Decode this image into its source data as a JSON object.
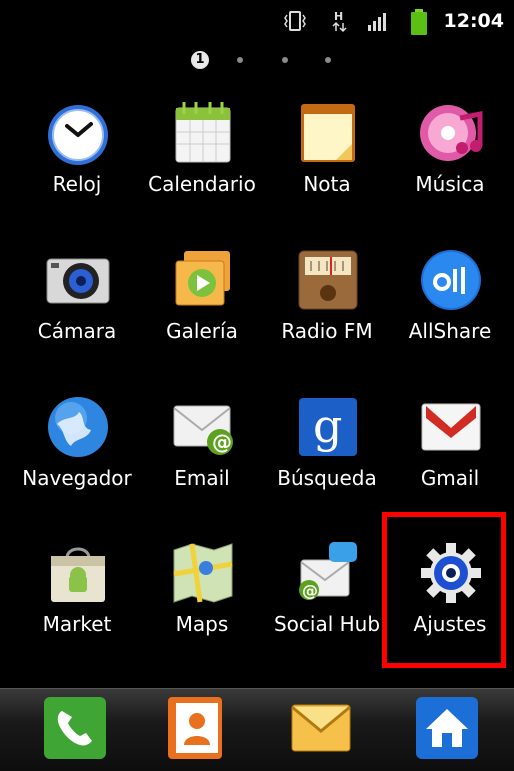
{
  "status_bar": {
    "time": "12:04",
    "icons": [
      "vibrate-icon",
      "hspa-data-icon",
      "signal-icon",
      "battery-icon"
    ]
  },
  "home": {
    "current_page": "1",
    "pages": 4
  },
  "apps": [
    {
      "label": "Reloj",
      "icon": "clock-icon"
    },
    {
      "label": "Calendario",
      "icon": "calendar-icon"
    },
    {
      "label": "Nota",
      "icon": "notepad-icon"
    },
    {
      "label": "Música",
      "icon": "music-disc-icon"
    },
    {
      "label": "Cámara",
      "icon": "camera-icon"
    },
    {
      "label": "Galería",
      "icon": "gallery-icon"
    },
    {
      "label": "Radio FM",
      "icon": "radio-icon"
    },
    {
      "label": "AllShare",
      "icon": "allshare-icon"
    },
    {
      "label": "Navegador",
      "icon": "globe-icon"
    },
    {
      "label": "Email",
      "icon": "email-icon"
    },
    {
      "label": "Búsqueda",
      "icon": "google-search-icon"
    },
    {
      "label": "Gmail",
      "icon": "gmail-icon"
    },
    {
      "label": "Market",
      "icon": "market-bag-icon"
    },
    {
      "label": "Maps",
      "icon": "maps-icon"
    },
    {
      "label": "Social Hub",
      "icon": "social-hub-icon"
    },
    {
      "label": "Ajustes",
      "icon": "settings-gear-icon"
    }
  ],
  "highlighted_app": "Ajustes",
  "highlight_color": "#ff0000",
  "dock": [
    "phone-icon",
    "contacts-icon",
    "messages-icon",
    "home-icon"
  ]
}
